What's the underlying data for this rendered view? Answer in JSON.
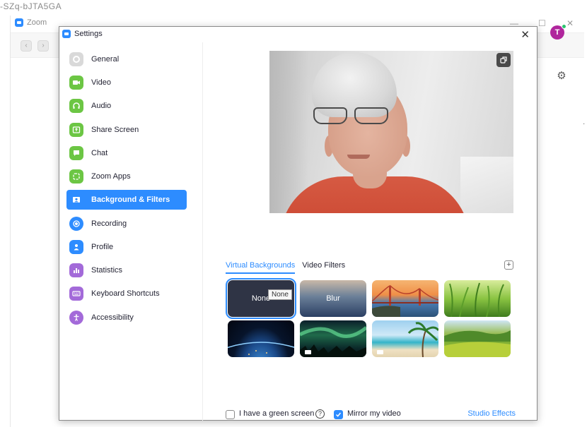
{
  "background_window": {
    "partial_top_text": "-SZq-bJTA5GA",
    "title": "Zoom",
    "avatar_initial": "T",
    "window_controls": [
      "—",
      "☐",
      "✕"
    ]
  },
  "dialog": {
    "title": "Settings",
    "close": "✕"
  },
  "sidebar": {
    "items": [
      {
        "label": "General",
        "icon": "gear-icon",
        "color": "#cfcfcf"
      },
      {
        "label": "Video",
        "icon": "video-camera-icon",
        "color": "#35c759"
      },
      {
        "label": "Audio",
        "icon": "headphones-icon",
        "color": "#35c759"
      },
      {
        "label": "Share Screen",
        "icon": "share-screen-icon",
        "color": "#35c759"
      },
      {
        "label": "Chat",
        "icon": "chat-bubble-icon",
        "color": "#35c759"
      },
      {
        "label": "Zoom Apps",
        "icon": "apps-icon",
        "color": "#35c759"
      },
      {
        "label": "Background & Filters",
        "icon": "portrait-icon",
        "color": "#ffffff"
      },
      {
        "label": "Recording",
        "icon": "record-icon",
        "color": "#2d8cff"
      },
      {
        "label": "Profile",
        "icon": "person-icon",
        "color": "#2d8cff"
      },
      {
        "label": "Statistics",
        "icon": "bar-chart-icon",
        "color": "#8a5cf6"
      },
      {
        "label": "Keyboard Shortcuts",
        "icon": "keyboard-icon",
        "color": "#8a5cf6"
      },
      {
        "label": "Accessibility",
        "icon": "accessibility-icon",
        "color": "#8a5cf6"
      }
    ],
    "active_index": 6
  },
  "background_filters": {
    "tabs": [
      "Virtual Backgrounds",
      "Video Filters"
    ],
    "active_tab": 0,
    "add_button": "+",
    "tiles": [
      {
        "label": "None",
        "kind": "none"
      },
      {
        "label": "Blur",
        "kind": "blur"
      },
      {
        "label": "",
        "kind": "golden-gate-bridge"
      },
      {
        "label": "",
        "kind": "grass"
      },
      {
        "label": "",
        "kind": "earth-from-space"
      },
      {
        "label": "",
        "kind": "aurora"
      },
      {
        "label": "",
        "kind": "beach"
      },
      {
        "label": "",
        "kind": "green-hills"
      }
    ],
    "selected_tile": 0,
    "tooltip": "None",
    "green_screen_label": "I have a green screen",
    "green_screen_checked": false,
    "mirror_label": "Mirror my video",
    "mirror_checked": true,
    "studio_effects": "Studio Effects"
  },
  "colors": {
    "accent": "#2d8cff",
    "selected_nav": "#2d8cff"
  }
}
